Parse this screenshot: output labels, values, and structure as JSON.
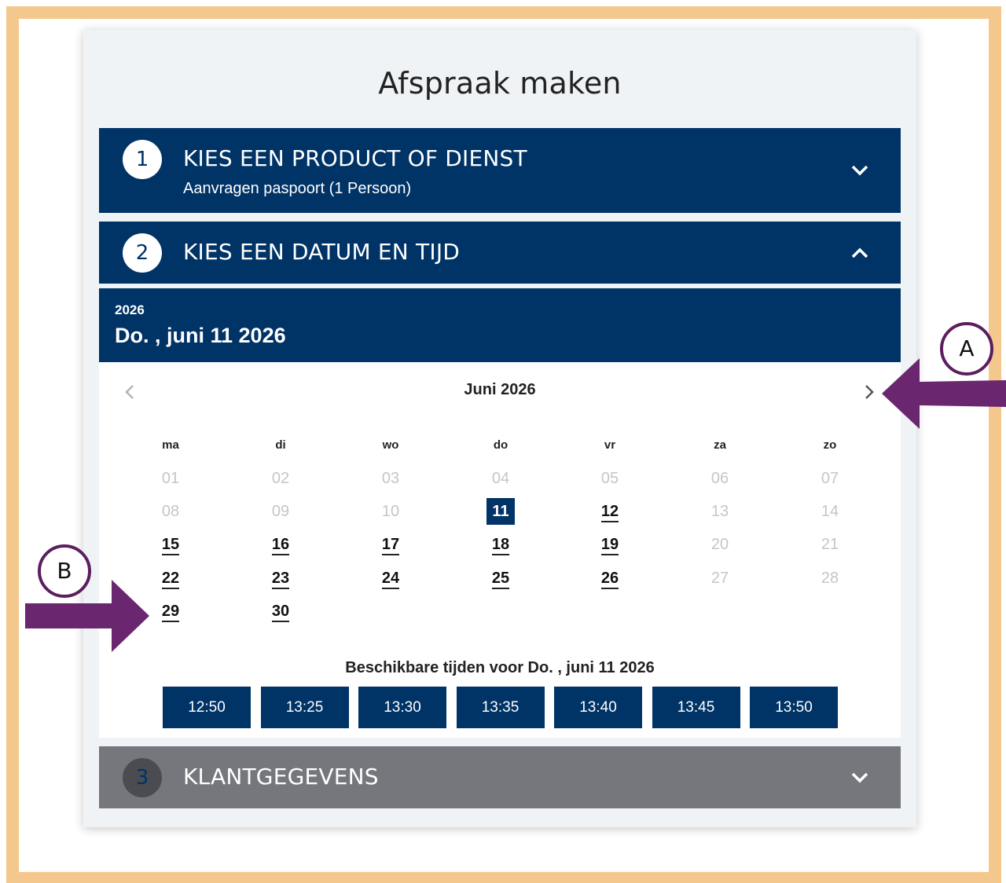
{
  "page_title": "Afspraak maken",
  "steps": [
    {
      "number": "1",
      "title": "KIES EEN PRODUCT OF DIENST",
      "subtitle": "Aanvragen paspoort (1 Persoon)",
      "state": "collapsed"
    },
    {
      "number": "2",
      "title": "KIES EEN DATUM EN TIJD",
      "state": "expanded"
    },
    {
      "number": "3",
      "title": "KLANTGEGEVENS",
      "state": "disabled"
    }
  ],
  "selected_date": {
    "year": "2026",
    "full": "Do. , juni 11 2026"
  },
  "calendar": {
    "month_label": "Juni 2026",
    "weekdays": [
      "ma",
      "di",
      "wo",
      "do",
      "vr",
      "za",
      "zo"
    ],
    "weeks": [
      [
        {
          "d": "01",
          "s": "disabled"
        },
        {
          "d": "02",
          "s": "disabled"
        },
        {
          "d": "03",
          "s": "disabled"
        },
        {
          "d": "04",
          "s": "disabled"
        },
        {
          "d": "05",
          "s": "disabled"
        },
        {
          "d": "06",
          "s": "disabled"
        },
        {
          "d": "07",
          "s": "disabled"
        }
      ],
      [
        {
          "d": "08",
          "s": "disabled"
        },
        {
          "d": "09",
          "s": "disabled"
        },
        {
          "d": "10",
          "s": "disabled"
        },
        {
          "d": "11",
          "s": "selected"
        },
        {
          "d": "12",
          "s": "available"
        },
        {
          "d": "13",
          "s": "disabled"
        },
        {
          "d": "14",
          "s": "disabled"
        }
      ],
      [
        {
          "d": "15",
          "s": "available"
        },
        {
          "d": "16",
          "s": "available"
        },
        {
          "d": "17",
          "s": "available"
        },
        {
          "d": "18",
          "s": "available"
        },
        {
          "d": "19",
          "s": "available"
        },
        {
          "d": "20",
          "s": "disabled"
        },
        {
          "d": "21",
          "s": "disabled"
        }
      ],
      [
        {
          "d": "22",
          "s": "available"
        },
        {
          "d": "23",
          "s": "available"
        },
        {
          "d": "24",
          "s": "available"
        },
        {
          "d": "25",
          "s": "available"
        },
        {
          "d": "26",
          "s": "available"
        },
        {
          "d": "27",
          "s": "disabled"
        },
        {
          "d": "28",
          "s": "disabled"
        }
      ],
      [
        {
          "d": "29",
          "s": "available"
        },
        {
          "d": "30",
          "s": "available"
        }
      ]
    ]
  },
  "times": {
    "label": "Beschikbare tijden voor Do. , juni 11 2026",
    "slots": [
      "12:50",
      "13:25",
      "13:30",
      "13:35",
      "13:40",
      "13:45",
      "13:50"
    ]
  },
  "annotations": {
    "a": "A",
    "b": "B"
  },
  "colors": {
    "primary": "#003366",
    "disabled_step": "#76777c",
    "frame": "#f4c88c",
    "annotation": "#5b1e5e",
    "arrow": "#6b2670"
  }
}
